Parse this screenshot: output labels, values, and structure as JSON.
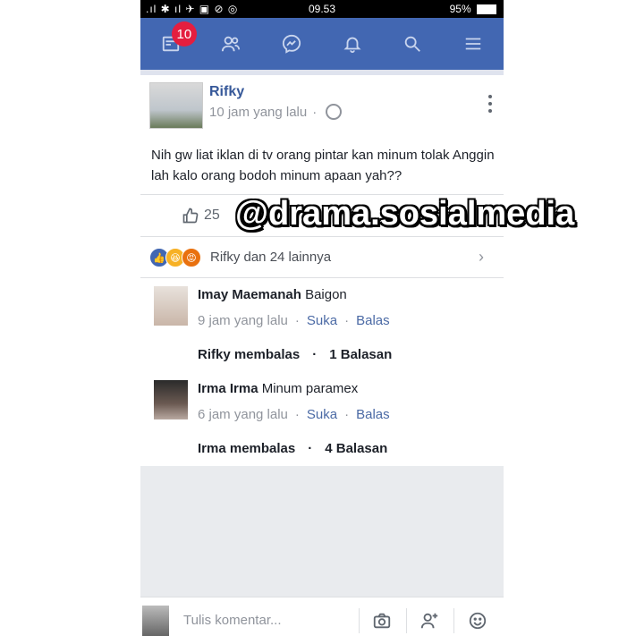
{
  "status_bar": {
    "left": ".ıl ✱ ıl ✈ ▣ ⊘ ◎",
    "time": "09.53",
    "right": "95%",
    "battery_icon": "battery-icon"
  },
  "nav": {
    "badge_count": "10",
    "icons": [
      "news-feed-icon",
      "friends-icon",
      "messenger-icon",
      "notifications-icon",
      "search-icon",
      "menu-icon"
    ],
    "bar_color": "#4267b2"
  },
  "post": {
    "author": "Rifky",
    "time": "10 jam yang lalu",
    "separator": "·",
    "text": "Nih gw liat iklan di tv orang pintar kan minum tolak Anggin lah kalo orang bodoh minum apaan yah??",
    "like_count": "25"
  },
  "reactions": {
    "text": "Rifky dan 24 lainnya"
  },
  "comments": [
    {
      "name": "Imay Maemanah",
      "text": "Baigon",
      "time": "9 jam yang lalu",
      "like_label": "Suka",
      "reply_label": "Balas",
      "replied_by": "Rifky membalas",
      "reply_count": "1 Balasan"
    },
    {
      "name": "Irma Irma",
      "text": "Minum paramex",
      "time": "6 jam yang lalu",
      "like_label": "Suka",
      "reply_label": "Balas",
      "replied_by": "Irma membalas",
      "reply_count": "4 Balasan"
    }
  ],
  "composer": {
    "placeholder": "Tulis komentar..."
  },
  "watermark": "@drama.sosialmedia"
}
